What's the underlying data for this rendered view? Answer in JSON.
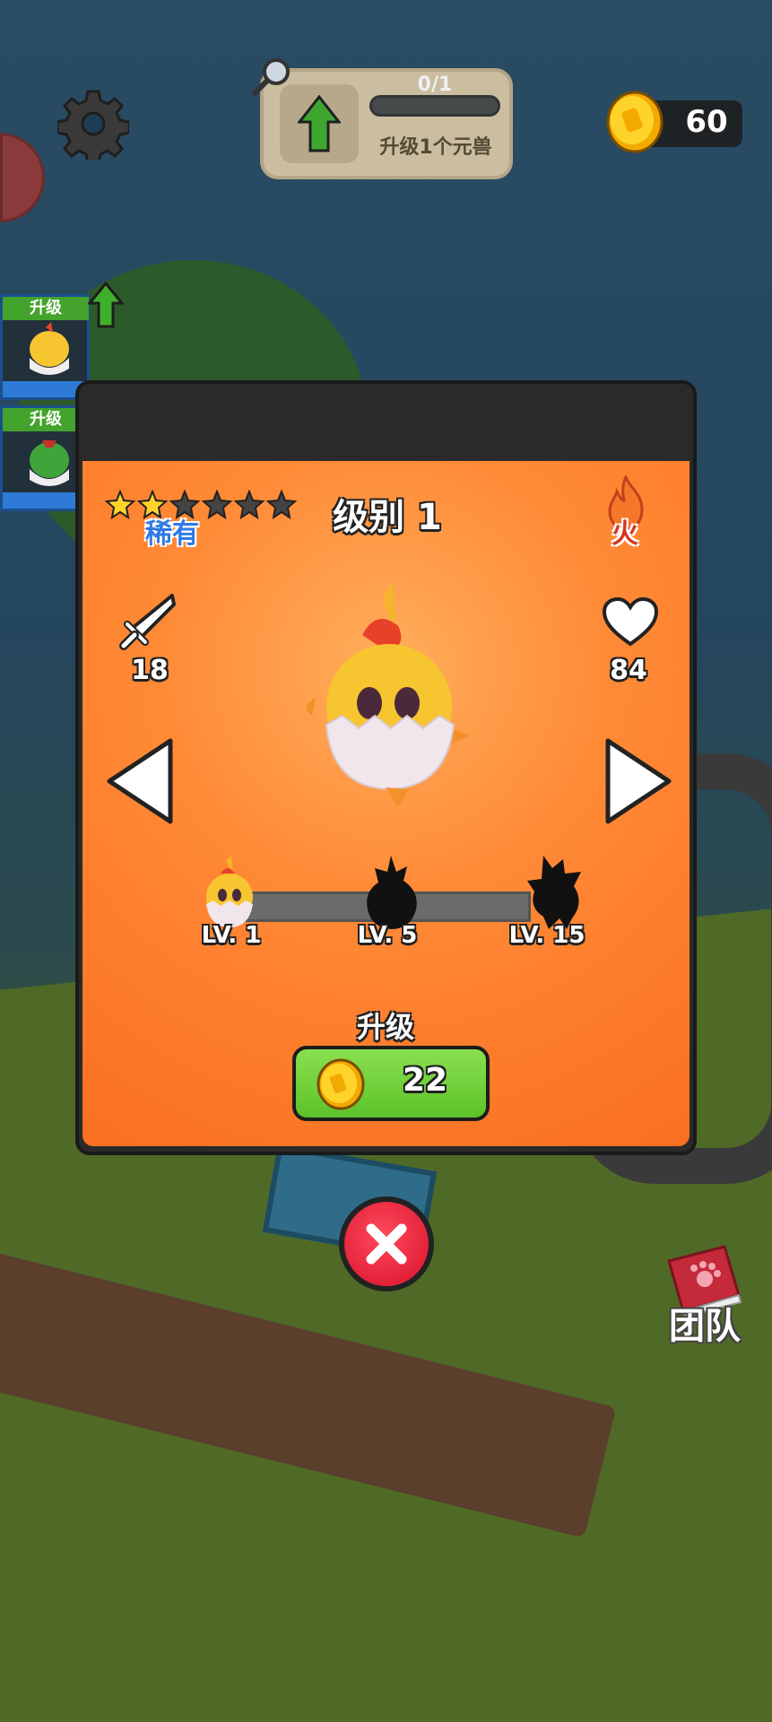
{
  "hud": {
    "quest_progress_text": "0/1",
    "quest_progress_fraction": 0,
    "quest_label": "升级1个元兽",
    "coins": "60"
  },
  "side_list": [
    {
      "label": "升级",
      "creature": "yellow-chick"
    },
    {
      "label": "升级",
      "creature": "green-chick"
    }
  ],
  "dialog": {
    "rarity_stars_filled": 2,
    "rarity_stars_total": 6,
    "rarity": "稀有",
    "level_title": "级别 1",
    "element": "火",
    "attack": "18",
    "hp": "84",
    "evolution": [
      {
        "label": "LV. 1",
        "unlocked": true
      },
      {
        "label": "LV. 5",
        "unlocked": false
      },
      {
        "label": "LV. 15",
        "unlocked": false
      }
    ],
    "upgrade_label": "升级",
    "upgrade_cost": "22"
  },
  "team_label": "团队",
  "colors": {
    "panel_orange": "#fa6f22",
    "upgrade_green": "#5cc22a",
    "close_red": "#e32239",
    "rarity_blue": "#2f7ae6",
    "coin_gold": "#f7c21a"
  }
}
